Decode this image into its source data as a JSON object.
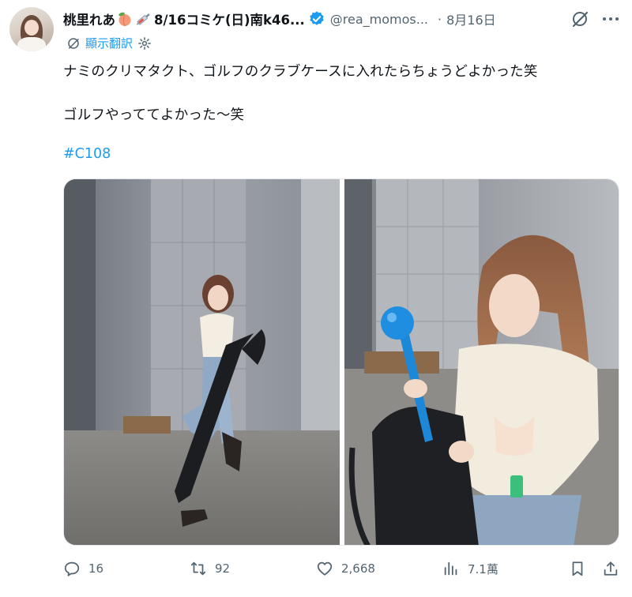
{
  "author": {
    "display_name_prefix": "桃里れあ",
    "display_name_suffix": "8/16コミケ(日)南k46...",
    "handle": "@rea_momos...",
    "date": "8月16日"
  },
  "translate": {
    "label": "翻訳",
    "prefix": "顯示"
  },
  "post": {
    "line1": "ナミのクリマタクト、ゴルフのクラブケースに入れたらちょうどよかった笑",
    "line2": "ゴルフやっててよかった〜笑",
    "hashtag": "#C108"
  },
  "actions": {
    "reply_count": "16",
    "repost_count": "92",
    "like_count": "2,668",
    "view_count": "7.1萬"
  },
  "icons": [
    "peach-emoji-icon",
    "syringe-emoji-icon",
    "verified-badge-icon",
    "grok-slash-icon",
    "more-icon",
    "translate-icon",
    "gear-icon",
    "reply-icon",
    "repost-icon",
    "like-icon",
    "views-icon",
    "bookmark-icon",
    "share-icon"
  ],
  "colors": {
    "accent": "#1d9bf0",
    "muted": "#536471",
    "text": "#0f1419"
  }
}
